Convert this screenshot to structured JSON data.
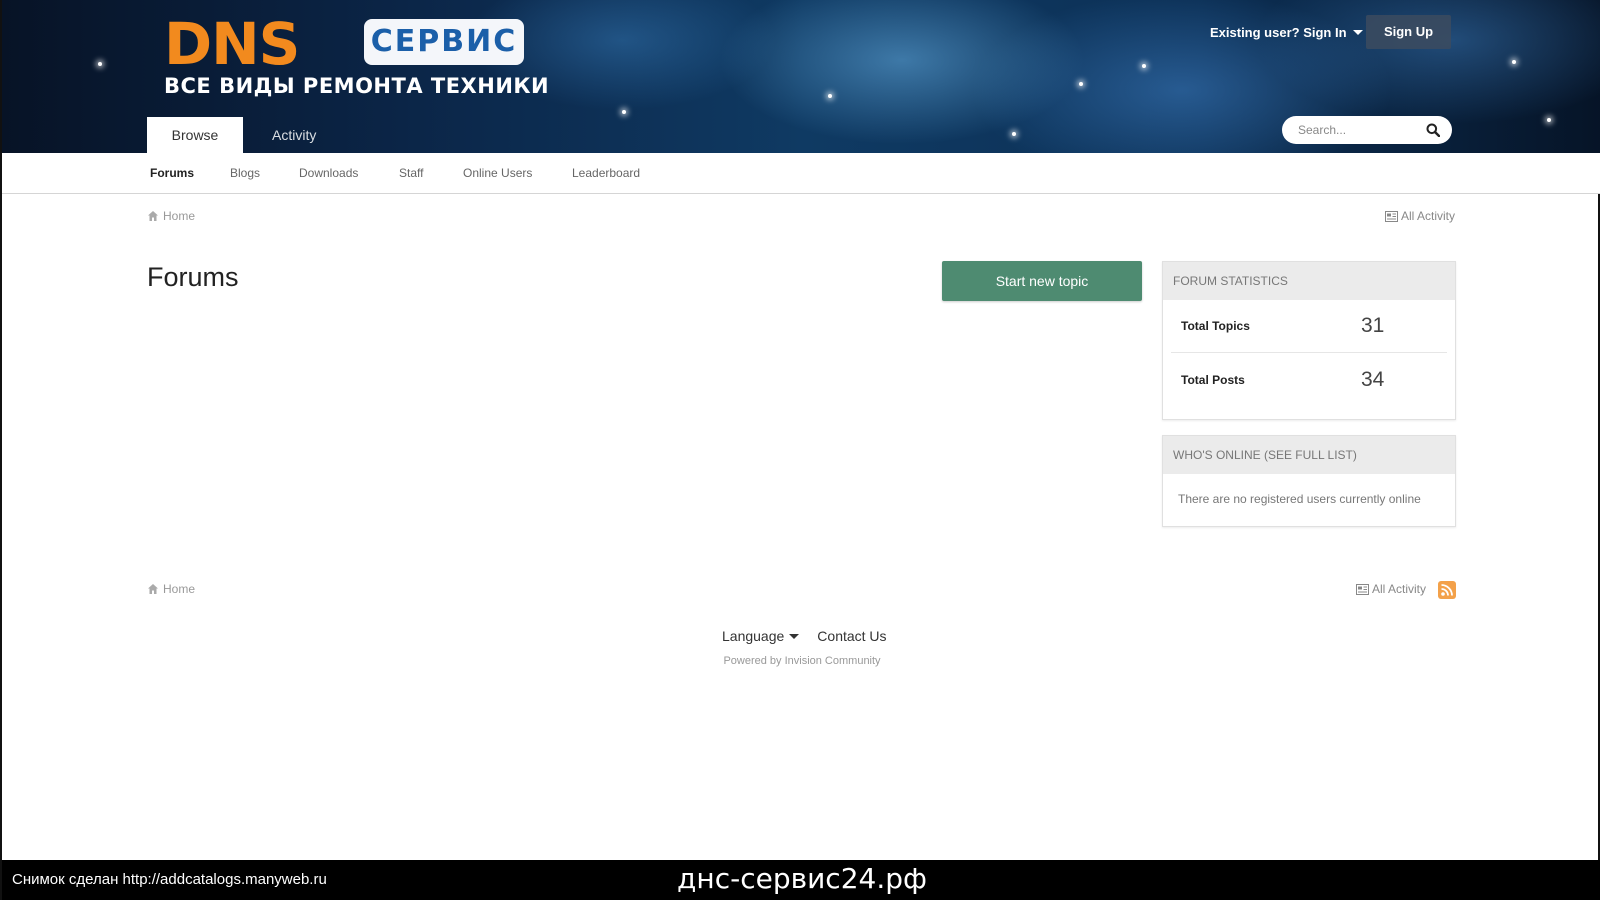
{
  "header": {
    "logo": {
      "brand": "DNS",
      "badge": "СЕРВИС",
      "tagline": "ВСЕ ВИДЫ РЕМОНТА ТЕХНИКИ"
    },
    "signin_label": "Existing user? Sign In",
    "signup_label": "Sign Up",
    "tabs": [
      {
        "label": "Browse",
        "active": true
      },
      {
        "label": "Activity",
        "active": false
      }
    ],
    "search": {
      "placeholder": "Search..."
    }
  },
  "subnav": {
    "items": [
      {
        "label": "Forums",
        "active": true
      },
      {
        "label": "Blogs"
      },
      {
        "label": "Downloads"
      },
      {
        "label": "Staff"
      },
      {
        "label": "Online Users"
      },
      {
        "label": "Leaderboard"
      }
    ]
  },
  "breadcrumb": {
    "home": "Home",
    "all_activity": "All Activity"
  },
  "main": {
    "title": "Forums",
    "start_topic_label": "Start new topic"
  },
  "widgets": {
    "forum_statistics": {
      "title": "Forum Statistics",
      "rows": [
        {
          "label": "Total Topics",
          "value": "31"
        },
        {
          "label": "Total Posts",
          "value": "34"
        }
      ]
    },
    "whos_online": {
      "title": "Who's Online (See full list)",
      "message": "There are no registered users currently online"
    }
  },
  "footer": {
    "home": "Home",
    "all_activity": "All Activity",
    "language_label": "Language",
    "contact_label": "Contact Us",
    "powered_by": "Powered by Invision Community"
  },
  "overlay": {
    "screenshot_note": "Снимок сделан http://addcatalogs.manyweb.ru",
    "domain": "днс-сервис24.рф"
  },
  "colors": {
    "accent_button": "#4e8b71",
    "brand_orange": "#f28a1e",
    "brand_blue": "#1b5fa9",
    "rss_orange": "#f3a14a"
  }
}
